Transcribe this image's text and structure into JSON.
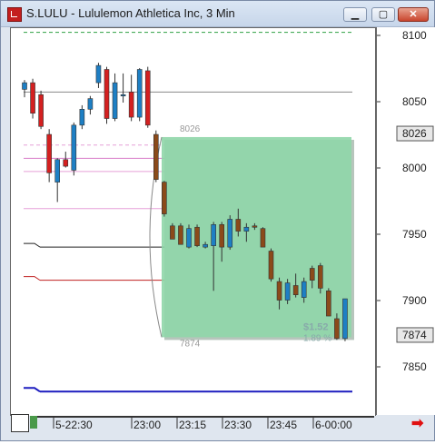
{
  "window": {
    "title": "S.LULU - Lululemon Athletica Inc, 3 Min",
    "btn_minimize": "▁",
    "btn_maximize": "▢",
    "btn_close": "✕"
  },
  "price_axis": {
    "labels": [
      "8100",
      "8050",
      "8000",
      "7950",
      "7900",
      "7850"
    ],
    "marker_top": "8026",
    "marker_bottom": "7874"
  },
  "time_axis": {
    "labels": [
      "5-22:30",
      "23:00",
      "23:15",
      "23:30",
      "23:45",
      "6-00:00"
    ]
  },
  "annotations": {
    "box_top_price": "8026",
    "box_bottom_price": "7874",
    "box_change": "$1.52",
    "box_percent": "1.89 %"
  },
  "colors": {
    "up_candle": "#1e7fc4",
    "down_candle": "#d42020",
    "down_candle_2": "#8b4a1a",
    "box_fill": "#8fd6a8",
    "blue_line": "#1d1dbf",
    "red_line": "#c02020",
    "pink_line": "#e080d0",
    "green_line": "#2ea043"
  },
  "chart_data": {
    "type": "candlestick",
    "y_unit": "price (cents)",
    "ylim": [
      7830,
      8110
    ],
    "candles": [
      {
        "o": 8060,
        "h": 8067,
        "l": 8054,
        "c": 8065
      },
      {
        "o": 8065,
        "h": 8068,
        "l": 8038,
        "c": 8042
      },
      {
        "o": 8056,
        "h": 8059,
        "l": 8030,
        "c": 8032
      },
      {
        "o": 8026,
        "h": 8030,
        "l": 7990,
        "c": 7997
      },
      {
        "o": 7990,
        "h": 8008,
        "l": 7975,
        "c": 8007
      },
      {
        "o": 8007,
        "h": 8013,
        "l": 8001,
        "c": 8002
      },
      {
        "o": 7999,
        "h": 8035,
        "l": 7995,
        "c": 8033
      },
      {
        "o": 8033,
        "h": 8048,
        "l": 8030,
        "c": 8045
      },
      {
        "o": 8045,
        "h": 8055,
        "l": 8041,
        "c": 8053
      },
      {
        "o": 8065,
        "h": 8080,
        "l": 8061,
        "c": 8078
      },
      {
        "o": 8075,
        "h": 8077,
        "l": 8034,
        "c": 8038
      },
      {
        "o": 8038,
        "h": 8072,
        "l": 8036,
        "c": 8065
      },
      {
        "o": 8056,
        "h": 8072,
        "l": 8050,
        "c": 8056
      },
      {
        "o": 8058,
        "h": 8071,
        "l": 8036,
        "c": 8039
      },
      {
        "o": 8039,
        "h": 8076,
        "l": 8036,
        "c": 8075
      },
      {
        "o": 8074,
        "h": 8077,
        "l": 8031,
        "c": 8033
      },
      {
        "o": 8026,
        "h": 8029,
        "l": 7990,
        "c": 7992
      },
      {
        "o": 7990,
        "h": 7991,
        "l": 7964,
        "c": 7966
      },
      {
        "o": 7957,
        "h": 7959,
        "l": 7947,
        "c": 7947
      },
      {
        "o": 7957,
        "h": 7959,
        "l": 7945,
        "c": 7943
      },
      {
        "o": 7941,
        "h": 7958,
        "l": 7940,
        "c": 7955
      },
      {
        "o": 7956,
        "h": 7958,
        "l": 7941,
        "c": 7942
      },
      {
        "o": 7941,
        "h": 7945,
        "l": 7940,
        "c": 7943
      },
      {
        "o": 7942,
        "h": 7960,
        "l": 7908,
        "c": 7958
      },
      {
        "o": 7958,
        "h": 7960,
        "l": 7930,
        "c": 7941
      },
      {
        "o": 7941,
        "h": 7965,
        "l": 7939,
        "c": 7962
      },
      {
        "o": 7962,
        "h": 7970,
        "l": 7949,
        "c": 7953
      },
      {
        "o": 7953,
        "h": 7959,
        "l": 7945,
        "c": 7956
      },
      {
        "o": 7957,
        "h": 7959,
        "l": 7954,
        "c": 7956
      },
      {
        "o": 7955,
        "h": 7956,
        "l": 7941,
        "c": 7941
      },
      {
        "o": 7938,
        "h": 7940,
        "l": 7915,
        "c": 7917
      },
      {
        "o": 7915,
        "h": 7918,
        "l": 7894,
        "c": 7901
      },
      {
        "o": 7901,
        "h": 7917,
        "l": 7898,
        "c": 7914
      },
      {
        "o": 7912,
        "h": 7921,
        "l": 7903,
        "c": 7905
      },
      {
        "o": 7903,
        "h": 7918,
        "l": 7899,
        "c": 7915
      },
      {
        "o": 7925,
        "h": 7927,
        "l": 7910,
        "c": 7916
      },
      {
        "o": 7927,
        "h": 7929,
        "l": 7906,
        "c": 7910
      },
      {
        "o": 7908,
        "h": 7910,
        "l": 7889,
        "c": 7889
      },
      {
        "o": 7887,
        "h": 7891,
        "l": 7871,
        "c": 7872
      },
      {
        "o": 7872,
        "h": 7902,
        "l": 7870,
        "c": 7902
      }
    ],
    "lines": [
      {
        "name": "green-dashed-top",
        "y": 8103,
        "color": "#2ea043",
        "dash": true
      },
      {
        "name": "gray-line",
        "y": 8058,
        "color": "#888888",
        "dash": false
      },
      {
        "name": "pink-line-1",
        "y": 8018,
        "color": "#e6a0d8",
        "dash": true
      },
      {
        "name": "pink-line-2",
        "y": 8008,
        "color": "#d87cc8",
        "dash": false
      },
      {
        "name": "pink-line-3",
        "y": 7998,
        "color": "#e6a0d8",
        "dash": false
      },
      {
        "name": "pink-line-4",
        "y": 7970,
        "color": "#e6a0d8",
        "dash": false
      },
      {
        "name": "black-line",
        "y": 7941,
        "color": "#222222",
        "dash": false
      },
      {
        "name": "red-line",
        "y": 7916,
        "color": "#c02020",
        "dash": false
      },
      {
        "name": "blue-line",
        "y": 7832,
        "color": "#1d1dbf",
        "dash": false
      }
    ],
    "box": {
      "y_top": 8024,
      "y_bottom": 7873
    }
  }
}
